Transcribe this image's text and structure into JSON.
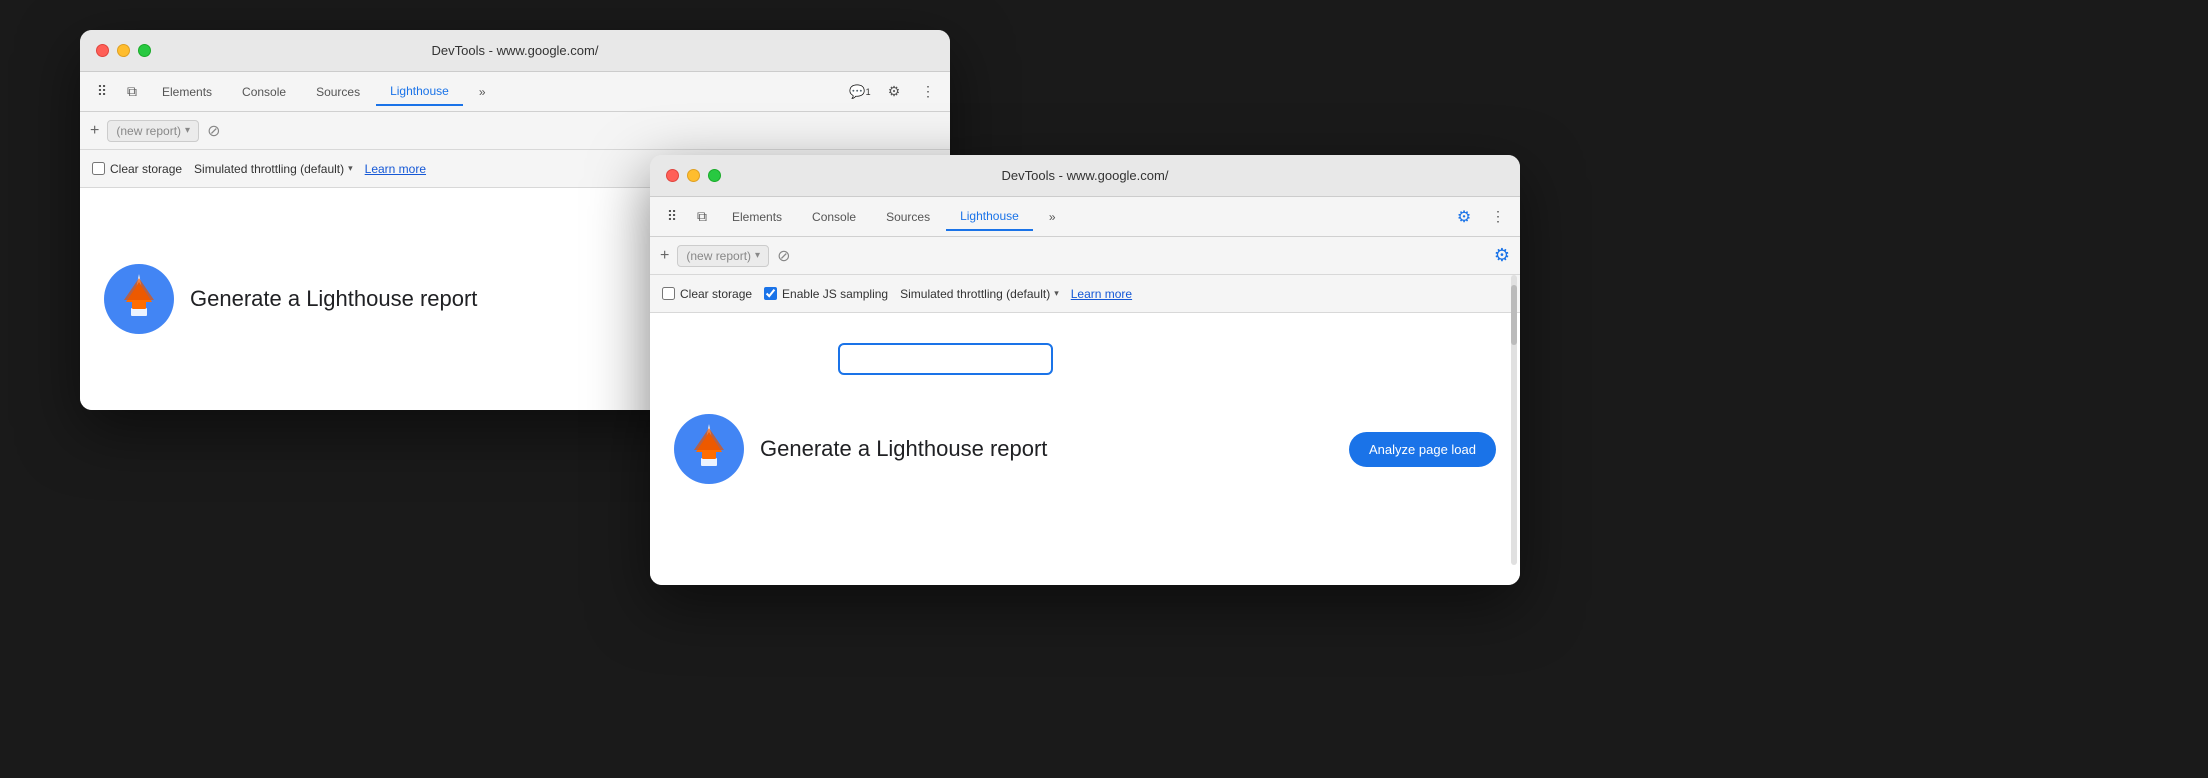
{
  "window_back": {
    "titlebar": {
      "title": "DevTools - www.google.com/"
    },
    "tabs": {
      "icon1": "⠿",
      "icon2": "⧉",
      "elements": "Elements",
      "console": "Console",
      "sources": "Sources",
      "lighthouse": "Lighthouse",
      "more": "»"
    },
    "toolbar_right": {
      "badge": "1",
      "gear": "⚙",
      "more": "⋮"
    },
    "report_bar": {
      "add": "+",
      "placeholder": "(new report)",
      "arrow": "▾",
      "cancel": "⊘"
    },
    "options_bar": {
      "clear_storage": "Clear storage",
      "throttling": "Simulated throttling (default)",
      "arrow": "▾",
      "learn_more": "Learn more"
    },
    "main": {
      "title": "Generate a Lighthouse report"
    }
  },
  "window_front": {
    "titlebar": {
      "title": "DevTools - www.google.com/"
    },
    "tabs": {
      "icon1": "⠿",
      "icon2": "⧉",
      "elements": "Elements",
      "console": "Console",
      "sources": "Sources",
      "lighthouse": "Lighthouse",
      "more": "»"
    },
    "toolbar_right": {
      "gear": "⚙",
      "more": "⋮",
      "settings_blue": "⚙"
    },
    "report_bar": {
      "add": "+",
      "placeholder": "(new report)",
      "arrow": "▾",
      "cancel": "⊘"
    },
    "options_bar": {
      "clear_storage": "Clear storage",
      "enable_js": "Enable JS sampling",
      "throttling": "Simulated throttling (default)",
      "arrow": "▾",
      "learn_more": "Learn more"
    },
    "main": {
      "title": "Generate a Lighthouse report",
      "analyze_btn": "Analyze page load"
    }
  }
}
